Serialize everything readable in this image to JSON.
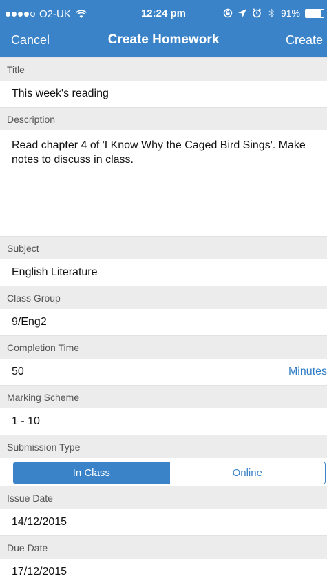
{
  "status_bar": {
    "carrier": "O2-UK",
    "time": "12:24 pm",
    "battery": "91%",
    "battery_level": 0.91,
    "icons": [
      "signal-dots-icon",
      "wifi-icon",
      "location-lock-icon",
      "location-arrow-icon",
      "alarm-icon",
      "bluetooth-icon",
      "battery-icon"
    ]
  },
  "nav": {
    "cancel_label": "Cancel",
    "title": "Create Homework",
    "create_label": "Create"
  },
  "form": {
    "title_label": "Title",
    "title_value": "This week's reading",
    "description_label": "Description",
    "description_value": "Read chapter 4 of 'I Know Why the Caged Bird Sings'. Make notes to discuss in class.",
    "subject_label": "Subject",
    "subject_value": "English Literature",
    "class_group_label": "Class Group",
    "class_group_value": "9/Eng2",
    "completion_time_label": "Completion Time",
    "completion_time_value": "50",
    "completion_time_unit": "Minutes",
    "marking_scheme_label": "Marking Scheme",
    "marking_scheme_value": "1 - 10",
    "submission_type_label": "Submission Type",
    "submission_options": [
      "In Class",
      "Online"
    ],
    "submission_selected": "In Class",
    "issue_date_label": "Issue Date",
    "issue_date_value": "14/12/2015",
    "due_date_label": "Due Date",
    "due_date_value": "17/12/2015"
  },
  "colors": {
    "accent": "#3a83c9",
    "section_bg": "#ececec",
    "link": "#2f7cc4"
  }
}
